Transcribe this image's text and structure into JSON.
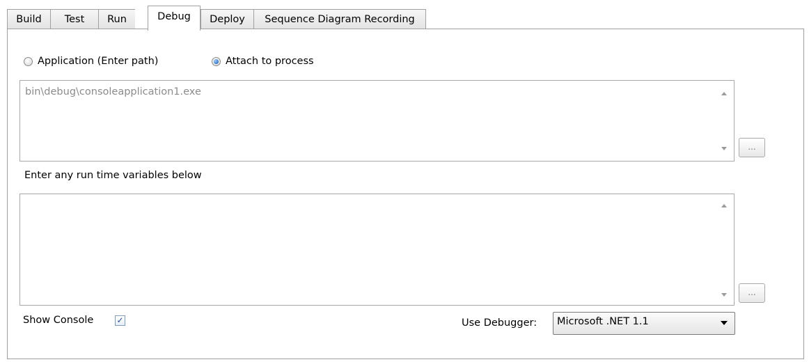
{
  "tabs": [
    {
      "label": "Build"
    },
    {
      "label": "Test"
    },
    {
      "label": "Run"
    },
    {
      "label": "Debug",
      "active": true
    },
    {
      "label": "Deploy"
    },
    {
      "label": "Sequence Diagram Recording"
    }
  ],
  "mode": {
    "application_label": "Application (Enter path)",
    "attach_label": "Attach to process",
    "selected": "attach"
  },
  "path_box": {
    "value": "bin\\debug\\consoleapplication1.exe",
    "browse_label": "..."
  },
  "runtime": {
    "label": "Enter any run time variables below",
    "value": "",
    "browse_label": "..."
  },
  "show_console": {
    "label": "Show Console",
    "checked": true,
    "check_glyph": "✓"
  },
  "debugger": {
    "label": "Use Debugger:",
    "value": "Microsoft .NET 1.1"
  }
}
